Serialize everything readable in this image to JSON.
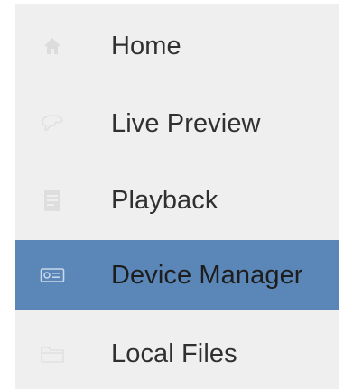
{
  "sidebar": {
    "items": [
      {
        "label": "Home",
        "icon": "home-icon",
        "active": false
      },
      {
        "label": "Live Preview",
        "icon": "live-preview-icon",
        "active": false
      },
      {
        "label": "Playback",
        "icon": "playback-icon",
        "active": false
      },
      {
        "label": "Device Manager",
        "icon": "device-manager-icon",
        "active": true
      },
      {
        "label": "Local Files",
        "icon": "folder-icon",
        "active": false
      }
    ],
    "colors": {
      "background": "#efefef",
      "active_background": "#5b87b8",
      "icon_inactive": "#e2e2e2",
      "text": "#303030"
    }
  }
}
